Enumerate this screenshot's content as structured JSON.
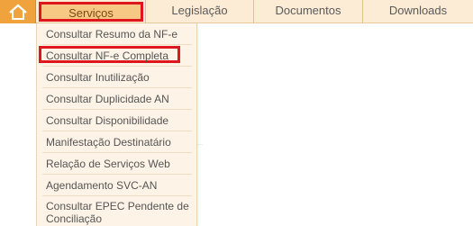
{
  "nav": {
    "items": [
      {
        "label": "Serviços"
      },
      {
        "label": "Legislação"
      },
      {
        "label": "Documentos"
      },
      {
        "label": "Downloads"
      }
    ]
  },
  "menu": {
    "items": [
      {
        "label": "Consultar Resumo da NF-e"
      },
      {
        "label": "Consultar NF-e Completa"
      },
      {
        "label": "Consultar Inutilização"
      },
      {
        "label": "Consultar Duplicidade AN"
      },
      {
        "label": "Consultar Disponibilidade"
      },
      {
        "label": "Manifestação Destinatário"
      },
      {
        "label": "Relação de Serviços Web"
      },
      {
        "label": "Agendamento SVC-AN"
      },
      {
        "label": "Consultar EPEC Pendente de Conciliação"
      }
    ]
  },
  "colors": {
    "accent": "#f0a23c",
    "highlight": "#e0161f",
    "nav_bg": "#fcecd6",
    "menu_bg": "#fdf3e6"
  },
  "icons": {
    "home": "home-icon"
  }
}
